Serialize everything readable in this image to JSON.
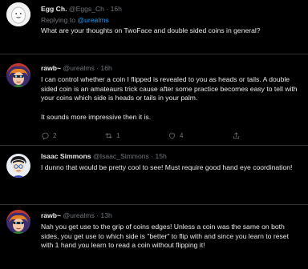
{
  "tweets": [
    {
      "name": "Egg Ch.",
      "handle": "@Eggs_Ch",
      "time": "16h",
      "replying_prefix": "Replying to",
      "replying_to": "@urealms",
      "body": "What are your thoughts on TwoFace and double sided coins in general?"
    },
    {
      "name": "rawb~",
      "handle": "@urealms",
      "time": "16h",
      "body_p1": "I can control whether a coin I flipped is revealed to you as heads or tails. A double sided coin is an amateaurs trick cause after some practice becomes easy to tell with your coins which side is heads or tails in your palm.",
      "body_p2": "It sounds more impressive then it is.",
      "replies": "2",
      "retweets": "1",
      "likes": "4"
    },
    {
      "name": "Isaac Simmons",
      "handle": "@Isaac_Simmons",
      "time": "15h",
      "body": "I dunno that would be pretty cool to see! Must require good hand eye coordination!"
    },
    {
      "name": "rawb~",
      "handle": "@urealms",
      "time": "13h",
      "body": "Nah you get use to the grip of coins edges! Unless a coin was the same on both sides, you get use to which side is \"better\" to flip with and since you learn to reset with 1 hand you learn to read a coin without flipping it!"
    }
  ],
  "separator": "·",
  "icons": [
    "reply-icon",
    "retweet-icon",
    "like-icon",
    "share-icon"
  ]
}
